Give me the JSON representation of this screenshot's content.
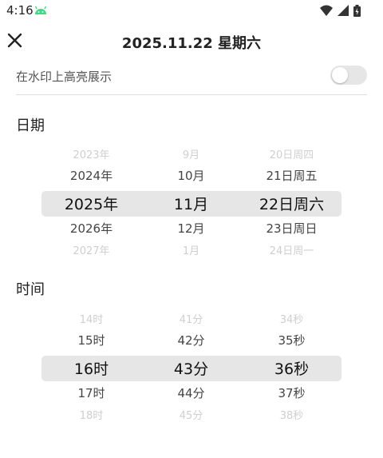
{
  "status_bar": {
    "time": "4:16"
  },
  "header": {
    "title": "2025.11.22 星期六"
  },
  "highlight": {
    "label": "在水印上高亮展示",
    "enabled": false
  },
  "date_section": {
    "title": "日期",
    "year": [
      "2023年",
      "2024年",
      "2025年",
      "2026年",
      "2027年"
    ],
    "month": [
      "9月",
      "10月",
      "11月",
      "12月",
      "1月"
    ],
    "day": [
      "20日周四",
      "21日周五",
      "22日周六",
      "23日周日",
      "24日周一"
    ]
  },
  "time_section": {
    "title": "时间",
    "hour": [
      "14时",
      "15时",
      "16时",
      "17时",
      "18时"
    ],
    "minute": [
      "41分",
      "42分",
      "43分",
      "44分",
      "45分"
    ],
    "second": [
      "34秒",
      "35秒",
      "36秒",
      "37秒",
      "38秒"
    ]
  },
  "colors": {
    "selection_band": "#e6e6e6",
    "toggle_off": "#e6e6e6",
    "text": "#222222",
    "faded_text": "#cfcfcf"
  }
}
